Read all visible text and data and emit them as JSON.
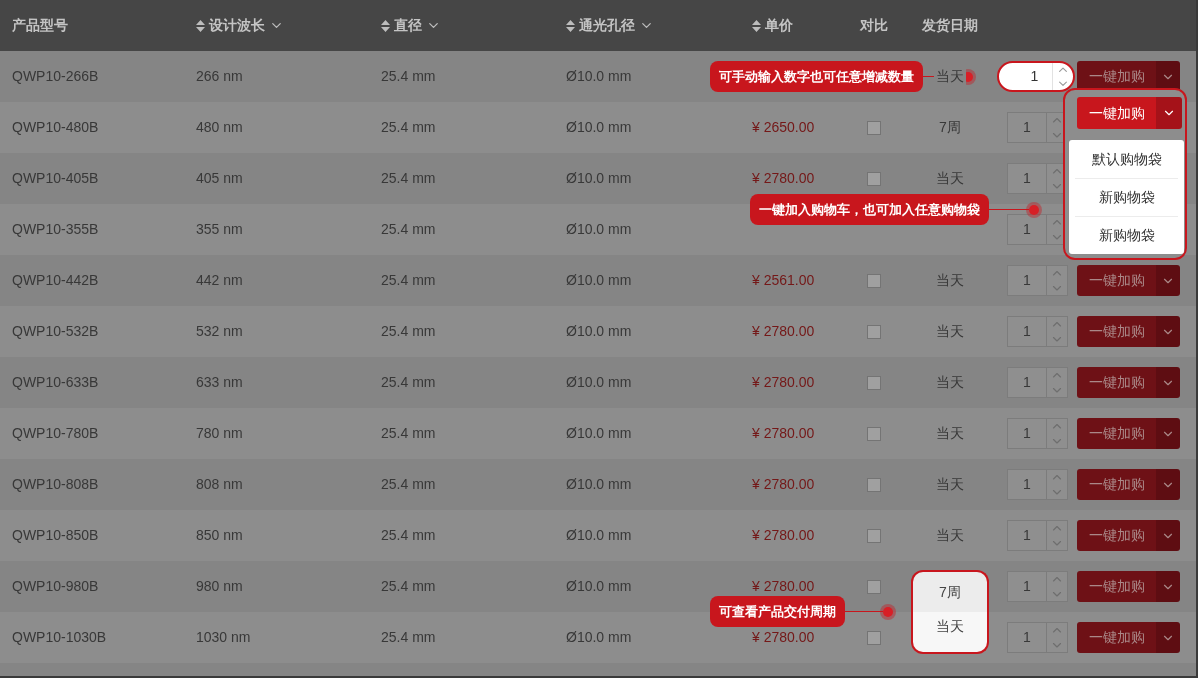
{
  "columns": [
    {
      "label": "产品型号",
      "sortable": false,
      "filter": false
    },
    {
      "label": "设计波长",
      "sortable": true,
      "filter": true
    },
    {
      "label": "直径",
      "sortable": true,
      "filter": true
    },
    {
      "label": "通光孔径",
      "sortable": true,
      "filter": true
    },
    {
      "label": "单价",
      "sortable": true,
      "filter": false
    },
    {
      "label": "对比",
      "sortable": false,
      "filter": false
    },
    {
      "label": "发货日期",
      "sortable": false,
      "filter": false
    }
  ],
  "rows": [
    {
      "model": "QWP10-266B",
      "wavelength": "266 nm",
      "diameter": "25.4 mm",
      "aperture": "Ø10.0 mm",
      "delivery": "当天",
      "qty": "1",
      "cart": "一键加购",
      "qty_focus": true,
      "cart_focus": false,
      "delivery_focus": false
    },
    {
      "model": "QWP10-480B",
      "wavelength": "480 nm",
      "diameter": "25.4 mm",
      "aperture": "Ø10.0 mm",
      "price": "¥ 2650.00",
      "compare": false,
      "delivery": "7周",
      "qty": "1",
      "cart": "一键加购",
      "qty_focus": false,
      "cart_focus": true,
      "delivery_focus": false,
      "cart_menu": [
        "默认购物袋",
        "新购物袋",
        "新购物袋"
      ]
    },
    {
      "model": "QWP10-405B",
      "wavelength": "405 nm",
      "diameter": "25.4 mm",
      "aperture": "Ø10.0 mm",
      "price": "¥ 2780.00",
      "compare": false,
      "delivery": "当天",
      "qty": "1",
      "qty_focus": false,
      "cart_focus": false,
      "delivery_focus": false
    },
    {
      "model": "QWP10-355B",
      "wavelength": "355 nm",
      "diameter": "25.4 mm",
      "aperture": "Ø10.0 mm",
      "qty": "1",
      "qty_focus": false,
      "cart_focus": false,
      "delivery_focus": false
    },
    {
      "model": "QWP10-442B",
      "wavelength": "442 nm",
      "diameter": "25.4 mm",
      "aperture": "Ø10.0 mm",
      "price": "¥ 2561.00",
      "compare": false,
      "delivery": "当天",
      "qty": "1",
      "cart": "一键加购",
      "qty_focus": false,
      "cart_focus": false,
      "delivery_focus": false
    },
    {
      "model": "QWP10-532B",
      "wavelength": "532 nm",
      "diameter": "25.4 mm",
      "aperture": "Ø10.0 mm",
      "price": "¥ 2780.00",
      "compare": false,
      "delivery": "当天",
      "qty": "1",
      "cart": "一键加购",
      "qty_focus": false,
      "cart_focus": false,
      "delivery_focus": false
    },
    {
      "model": "QWP10-633B",
      "wavelength": "633 nm",
      "diameter": "25.4 mm",
      "aperture": "Ø10.0 mm",
      "price": "¥ 2780.00",
      "compare": false,
      "delivery": "当天",
      "qty": "1",
      "cart": "一键加购",
      "qty_focus": false,
      "cart_focus": false,
      "delivery_focus": false
    },
    {
      "model": "QWP10-780B",
      "wavelength": "780 nm",
      "diameter": "25.4 mm",
      "aperture": "Ø10.0 mm",
      "price": "¥ 2780.00",
      "compare": false,
      "delivery": "当天",
      "qty": "1",
      "cart": "一键加购",
      "qty_focus": false,
      "cart_focus": false,
      "delivery_focus": false
    },
    {
      "model": "QWP10-808B",
      "wavelength": "808 nm",
      "diameter": "25.4 mm",
      "aperture": "Ø10.0 mm",
      "price": "¥ 2780.00",
      "compare": false,
      "delivery": "当天",
      "qty": "1",
      "cart": "一键加购",
      "qty_focus": false,
      "cart_focus": false,
      "delivery_focus": false
    },
    {
      "model": "QWP10-850B",
      "wavelength": "850 nm",
      "diameter": "25.4 mm",
      "aperture": "Ø10.0 mm",
      "price": "¥ 2780.00",
      "compare": false,
      "delivery": "当天",
      "qty": "1",
      "cart": "一键加购",
      "qty_focus": false,
      "cart_focus": false,
      "delivery_focus": false
    },
    {
      "model": "QWP10-980B",
      "wavelength": "980 nm",
      "diameter": "25.4 mm",
      "aperture": "Ø10.0 mm",
      "price": "¥ 2780.00",
      "compare": false,
      "delivery": "7周",
      "qty": "1",
      "cart": "一键加购",
      "qty_focus": false,
      "cart_focus": false,
      "delivery_focus": true
    },
    {
      "model": "QWP10-1030B",
      "wavelength": "1030 nm",
      "diameter": "25.4 mm",
      "aperture": "Ø10.0 mm",
      "price": "¥ 2780.00",
      "compare": false,
      "delivery": "当天",
      "qty": "1",
      "cart": "一键加购",
      "qty_focus": false,
      "cart_focus": false,
      "delivery_focus": true
    }
  ],
  "callouts": [
    {
      "text": "可手动输入数字也可任意增减数量"
    },
    {
      "text": "一键加入购物车，也可加入任意购物袋"
    },
    {
      "text": "可查看产品交付周期"
    }
  ]
}
